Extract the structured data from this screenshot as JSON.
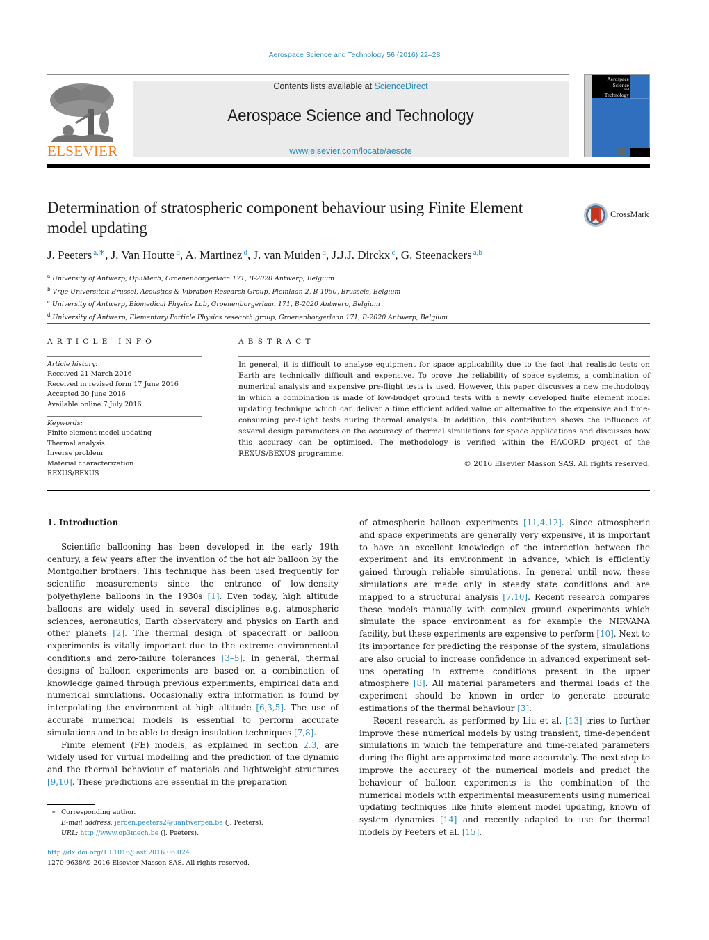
{
  "header": {
    "citation": "Aerospace Science and Technology 56 (2016) 22–28",
    "publisher_logo_text": "ELSEVIER",
    "contents_prefix": "Contents lists available at ",
    "contents_link": "ScienceDirect",
    "journal_name": "Aerospace Science and Technology",
    "journal_url": "www.elsevier.com/locate/aescte",
    "cover_title_lines": [
      "Aerospace",
      "Science",
      "and",
      "Technology"
    ],
    "crossmark_label": "CrossMark"
  },
  "article": {
    "title": "Determination of stratospheric component behaviour using Finite Element model updating",
    "authors": [
      {
        "name": "J. Peeters",
        "sup": "a,∗"
      },
      {
        "name": "J. Van Houtte",
        "sup": "d"
      },
      {
        "name": "A. Martinez",
        "sup": "d"
      },
      {
        "name": "J. van Muiden",
        "sup": "d"
      },
      {
        "name": "J.J.J. Dirckx",
        "sup": "c"
      },
      {
        "name": "G. Steenackers",
        "sup": "a,b"
      }
    ],
    "affiliations": [
      {
        "key": "a",
        "text": "University of Antwerp, Op3Mech, Groenenborgerlaan 171, B-2020 Antwerp, Belgium"
      },
      {
        "key": "b",
        "text": "Vrije Universiteit Brussel, Acoustics & Vibration Research Group, Pleinlaan 2, B-1050, Brussels, Belgium"
      },
      {
        "key": "c",
        "text": "University of Antwerp, Biomedical Physics Lab, Groenenborgerlaan 171, B-2020 Antwerp, Belgium"
      },
      {
        "key": "d",
        "text": "University of Antwerp, Elementary Particle Physics research group, Groenenborgerlaan 171, B-2020 Antwerp, Belgium"
      }
    ]
  },
  "article_info": {
    "heading": "ARTICLE INFO",
    "history_label": "Article history:",
    "history": [
      "Received 21 March 2016",
      "Received in revised form 17 June 2016",
      "Accepted 30 June 2016",
      "Available online 7 July 2016"
    ],
    "keywords_label": "Keywords:",
    "keywords": [
      "Finite element model updating",
      "Thermal analysis",
      "Inverse problem",
      "Material characterization",
      "REXUS/BEXUS"
    ]
  },
  "abstract": {
    "heading": "ABSTRACT",
    "text": "In general, it is difficult to analyse equipment for space applicability due to the fact that realistic tests on Earth are technically difficult and expensive. To prove the reliability of space systems, a combination of numerical analysis and expensive pre-flight tests is used. However, this paper discusses a new methodology in which a combination is made of low-budget ground tests with a newly developed finite element model updating technique which can deliver a time efficient added value or alternative to the expensive and time-consuming pre-flight tests during thermal analysis. In addition, this contribution shows the influence of several design parameters on the accuracy of thermal simulations for space applications and discusses how this accuracy can be optimised. The methodology is verified within the HACORD project of the REXUS/BEXUS programme.",
    "copyright": "© 2016 Elsevier Masson SAS. All rights reserved."
  },
  "body": {
    "section_heading": "1.  Introduction",
    "left_paragraphs": [
      [
        {
          "t": "Scientific ballooning has been developed in the early 19th century, a few years after the invention of the hot air balloon by the Montgolfier brothers. This technique has been used fre­quently for scientific measurements since the entrance of low-density polyethylene balloons in the 1930s "
        },
        {
          "ref": "[1]"
        },
        {
          "t": ". Even today, high altitude balloons are widely used in several disciplines e.g. at­mospheric sciences, aeronautics, Earth observatory and physics on Earth and other planets "
        },
        {
          "ref": "[2]"
        },
        {
          "t": ". The thermal design of spacecraft or balloon experiments is vitally important due to the extreme envi­ronmental conditions and zero-failure tolerances "
        },
        {
          "ref": "[3–5]"
        },
        {
          "t": ". In general, thermal designs of balloon experiments are based on a combina­tion of knowledge gained through previous experiments, empirical data and numerical simulations. Occasionally extra information is found by interpolating the environment at high altitude "
        },
        {
          "ref": "[6,3,5]"
        },
        {
          "t": ". The use of accurate numerical models is essential to perform accurate simulations and to be able to design insulation techniques "
        },
        {
          "ref": "[7,8]"
        },
        {
          "t": "."
        }
      ],
      [
        {
          "t": "Finite element (FE) models, as explained in section "
        },
        {
          "ref": "2.3"
        },
        {
          "t": ", are widely used for virtual modelling and the prediction of the dy­namic and the thermal behaviour of materials and lightweight structures "
        },
        {
          "ref": "[9,10]"
        },
        {
          "t": ". These predictions are essential in the preparation"
        }
      ]
    ],
    "right_paragraphs": [
      [
        {
          "t": "of atmospheric balloon experiments "
        },
        {
          "ref": "[11,4,12]"
        },
        {
          "t": ". Since atmospheric and space experiments are generally very expensive, it is impor­tant to have an excellent knowledge of the interaction between the experiment and its environment in advance, which is effi­ciently gained through reliable simulations. In general until now, these simulations are made only in steady state conditions and are mapped to a structural analysis "
        },
        {
          "ref": "[7,10]"
        },
        {
          "t": ". Recent research com­pares these models manually with complex ground experiments which simulate the space environment as for example the NIR­VANA facility, but these experiments are expensive to perform "
        },
        {
          "ref": "[10]"
        },
        {
          "t": ". Next to its importance for predicting the response of the system, simulations are also crucial to increase confidence in advanced ex­periment set-ups operating in extreme conditions present in the upper atmosphere "
        },
        {
          "ref": "[8]"
        },
        {
          "t": ". All material parameters and thermal loads of the experiment should be known in order to generate accurate estimations of the thermal behaviour "
        },
        {
          "ref": "[3]"
        },
        {
          "t": "."
        }
      ],
      [
        {
          "t": "Recent research, as performed by Liu et al. "
        },
        {
          "ref": "[13]"
        },
        {
          "t": " tries to fur­ther improve these numerical models by using transient, time-dependent simulations in which the temperature and time-related parameters during the flight are approximated more accurately. The next step to improve the accuracy of the numerical models and predict the behaviour of balloon experiments is the combi­nation of the numerical models with experimental measurements using numerical updating techniques like finite element model up­dating, known of system dynamics "
        },
        {
          "ref": "[14]"
        },
        {
          "t": " and recently adapted to use for thermal models by Peeters et al. "
        },
        {
          "ref": "[15]"
        },
        {
          "t": "."
        }
      ]
    ]
  },
  "footnotes": {
    "star": "∗",
    "corresponding": "Corresponding author.",
    "email_label": "E-mail address:",
    "email": "jeroen.peeters2@uantwerpen.be",
    "email_suffix": " (J. Peeters).",
    "url_label": "URL:",
    "url": "http://www.op3mech.be",
    "url_suffix": " (J. Peeters).",
    "doi": "http://dx.doi.org/10.1016/j.ast.2016.06.024",
    "issn_line": "1270-9638/© 2016 Elsevier Masson SAS. All rights reserved."
  },
  "colors": {
    "link": "#2a8ab8",
    "elsevier_orange": "#f07d1a",
    "banner_bg": "#ebebeb",
    "cover_blue": "#2f6fbd"
  }
}
